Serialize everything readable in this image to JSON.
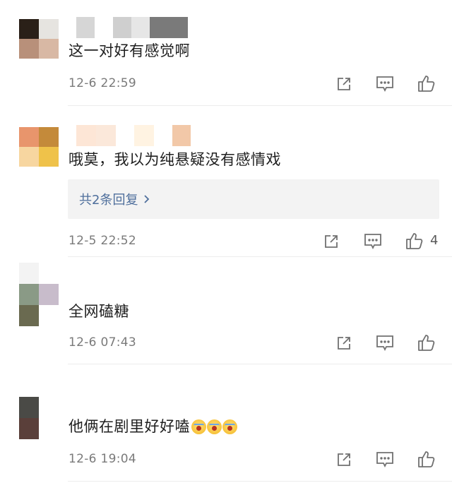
{
  "colors": {
    "link": "#4f6f9c",
    "icon": "#707070",
    "time": "#7a7a7a",
    "text": "#1f1f1f",
    "reply_bg": "#f3f3f3"
  },
  "icons": {
    "share": "share-icon",
    "comment": "comment-icon",
    "like": "thumbs-up-icon",
    "reply_arrow": "chevron-right-icon"
  },
  "comments": [
    {
      "text": "这一对好有感觉啊",
      "time": "12-6 22:59",
      "likes": ""
    },
    {
      "text": "哦莫，我以为纯悬疑没有感情戏",
      "replies_label": "共2条回复",
      "time": "12-5 22:52",
      "likes": "4"
    },
    {
      "text": "全网磕糖",
      "time": "12-6 07:43",
      "likes": ""
    },
    {
      "text": "他俩在剧里好好嗑",
      "emojis": [
        "screaming-face-emoji",
        "screaming-face-emoji",
        "screaming-face-emoji"
      ],
      "time": "12-6 19:04",
      "likes": ""
    }
  ]
}
